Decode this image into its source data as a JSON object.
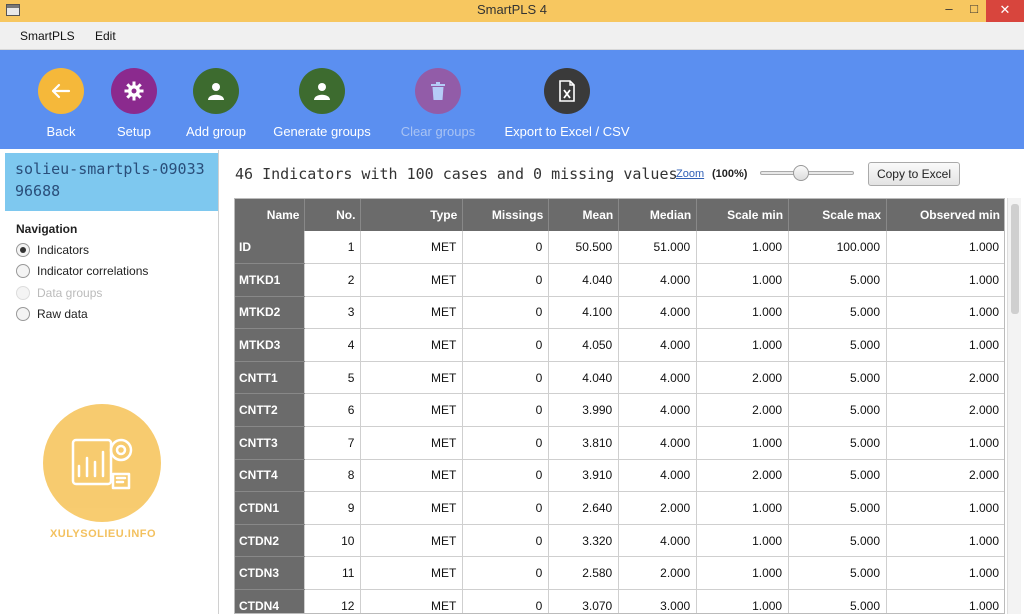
{
  "window": {
    "title": "SmartPLS 4"
  },
  "menu": [
    "SmartPLS",
    "Edit"
  ],
  "toolbar": [
    {
      "label": "Back",
      "icon": "back-arrow-icon",
      "color": "#f5b83a",
      "enabled": true
    },
    {
      "label": "Setup",
      "icon": "gear-icon",
      "color": "#8b2a8e",
      "enabled": true
    },
    {
      "label": "Add group",
      "icon": "person-icon",
      "color": "#3d6b2f",
      "enabled": true
    },
    {
      "label": "Generate groups",
      "icon": "person-icon",
      "color": "#3d6b2f",
      "enabled": true
    },
    {
      "label": "Clear groups",
      "icon": "trash-icon",
      "color": "#c0336e",
      "enabled": false
    },
    {
      "label": "Export to Excel / CSV",
      "icon": "excel-file-icon",
      "color": "#3a3a3a",
      "enabled": true
    }
  ],
  "project": {
    "name": "solieu-smartpls-0903396688"
  },
  "navigation": {
    "heading": "Navigation",
    "items": [
      {
        "label": "Indicators",
        "selected": true,
        "enabled": true
      },
      {
        "label": "Indicator correlations",
        "selected": false,
        "enabled": true
      },
      {
        "label": "Data groups",
        "selected": false,
        "enabled": false
      },
      {
        "label": "Raw data",
        "selected": false,
        "enabled": true
      }
    ]
  },
  "watermark": {
    "text": "XULYSOLIEU.INFO"
  },
  "summary": {
    "text": "46 Indicators with 100 cases and 0 missing values",
    "zoom_label": "Zoom",
    "zoom_value": "(100%)",
    "zoom_level_percent": 100,
    "copy_button": "Copy to Excel"
  },
  "table": {
    "columns": [
      "Name",
      "No.",
      "Type",
      "Missings",
      "Mean",
      "Median",
      "Scale min",
      "Scale max",
      "Observed min"
    ],
    "rows": [
      [
        "ID",
        "1",
        "MET",
        "0",
        "50.500",
        "51.000",
        "1.000",
        "100.000",
        "1.000"
      ],
      [
        "MTKD1",
        "2",
        "MET",
        "0",
        "4.040",
        "4.000",
        "1.000",
        "5.000",
        "1.000"
      ],
      [
        "MTKD2",
        "3",
        "MET",
        "0",
        "4.100",
        "4.000",
        "1.000",
        "5.000",
        "1.000"
      ],
      [
        "MTKD3",
        "4",
        "MET",
        "0",
        "4.050",
        "4.000",
        "1.000",
        "5.000",
        "1.000"
      ],
      [
        "CNTT1",
        "5",
        "MET",
        "0",
        "4.040",
        "4.000",
        "2.000",
        "5.000",
        "2.000"
      ],
      [
        "CNTT2",
        "6",
        "MET",
        "0",
        "3.990",
        "4.000",
        "2.000",
        "5.000",
        "2.000"
      ],
      [
        "CNTT3",
        "7",
        "MET",
        "0",
        "3.810",
        "4.000",
        "1.000",
        "5.000",
        "1.000"
      ],
      [
        "CNTT4",
        "8",
        "MET",
        "0",
        "3.910",
        "4.000",
        "2.000",
        "5.000",
        "2.000"
      ],
      [
        "CTDN1",
        "9",
        "MET",
        "0",
        "2.640",
        "2.000",
        "1.000",
        "5.000",
        "1.000"
      ],
      [
        "CTDN2",
        "10",
        "MET",
        "0",
        "3.320",
        "4.000",
        "1.000",
        "5.000",
        "1.000"
      ],
      [
        "CTDN3",
        "11",
        "MET",
        "0",
        "2.580",
        "2.000",
        "1.000",
        "5.000",
        "1.000"
      ],
      [
        "CTDN4",
        "12",
        "MET",
        "0",
        "3.070",
        "3.000",
        "1.000",
        "5.000",
        "1.000"
      ]
    ]
  }
}
